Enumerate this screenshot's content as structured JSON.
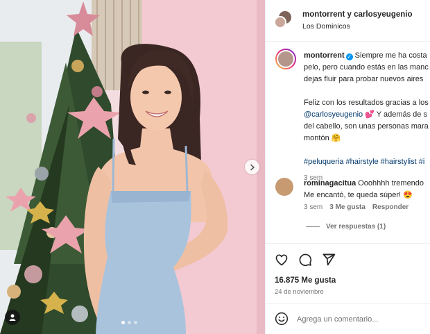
{
  "post": {
    "author_names": "montorrent y carlosyeugenio",
    "location": "Los Dominicos",
    "caption": {
      "username": "montorrent",
      "line1": "Siempre me ha costa",
      "line2": "pelo, pero cuando estás en las manc",
      "line3": "dejas fluir para probar nuevos aires",
      "line4": "Feliz con los resultados gracias a los",
      "mention": "@carlosyeugenio",
      "line5_rest": " 💕 Y además de s",
      "line6": "del cabello, son unas personas mara",
      "line7": "montón 🤗",
      "hashtags": "#peluqueria #hairstyle #hairstylist #i",
      "time": "3 sem"
    },
    "comment": {
      "username": "rominagacitua",
      "line1": "Ooohhhh tremendo",
      "line2": "Me encantó, te queda súper! 😍",
      "time": "3 sem",
      "likes": "3 Me gusta",
      "reply": "Responder",
      "view_replies": "Ver respuestas (1)"
    },
    "likes": "16.875 Me gusta",
    "date": "24 de noviembre",
    "composer_placeholder": "Agrega un comentario..."
  },
  "icons": {
    "verified": "verified-badge-icon",
    "like": "heart-icon",
    "comment": "speech-bubble-icon",
    "share": "paper-plane-icon",
    "emoji": "smiley-icon",
    "next": "chevron-right-icon",
    "tag": "person-icon"
  },
  "carousel": {
    "slides": 3,
    "active_slide": 1
  },
  "colors": {
    "verified": "#0095f6",
    "mention": "#00376b",
    "muted": "#737373"
  }
}
